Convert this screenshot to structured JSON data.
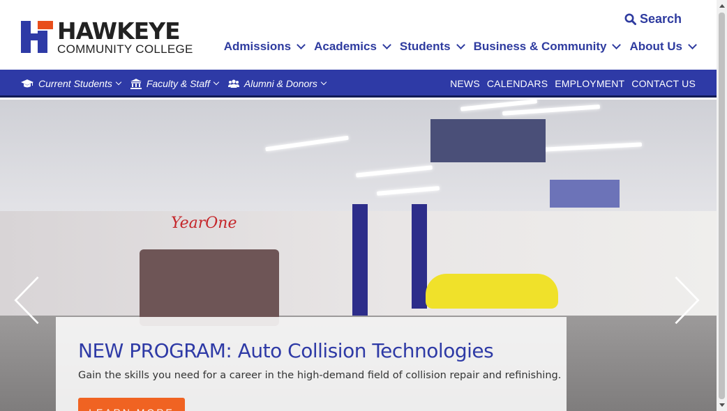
{
  "logo": {
    "line1": "HAWKEYE",
    "line2": "COMMUNITY COLLEGE",
    "brand_blue": "#2e3aa6",
    "brand_orange": "#e84e1b"
  },
  "search": {
    "label": "Search",
    "icon": "search-icon"
  },
  "main_nav": [
    {
      "label": "Admissions"
    },
    {
      "label": "Academics"
    },
    {
      "label": "Students"
    },
    {
      "label": "Business & Community"
    },
    {
      "label": "About Us"
    }
  ],
  "audience_nav": [
    {
      "label": "Current Students",
      "icon": "graduation-cap-icon"
    },
    {
      "label": "Faculty & Staff",
      "icon": "institution-icon"
    },
    {
      "label": "Alumni & Donors",
      "icon": "users-icon"
    }
  ],
  "utility_links": [
    {
      "label": "NEWS"
    },
    {
      "label": "CALENDARS"
    },
    {
      "label": "EMPLOYMENT"
    },
    {
      "label": "CONTACT US"
    }
  ],
  "hero": {
    "image_sign": "YearOne",
    "title": "NEW PROGRAM: Auto Collision Technologies",
    "description": "Gain the skills you need for a career in the high-demand field of collision repair and refinishing.",
    "button_label": "LEARN MORE"
  },
  "colors": {
    "nav_text": "#2e3b9f",
    "util_bar": "#2e3aa6",
    "button": "#f06322"
  }
}
